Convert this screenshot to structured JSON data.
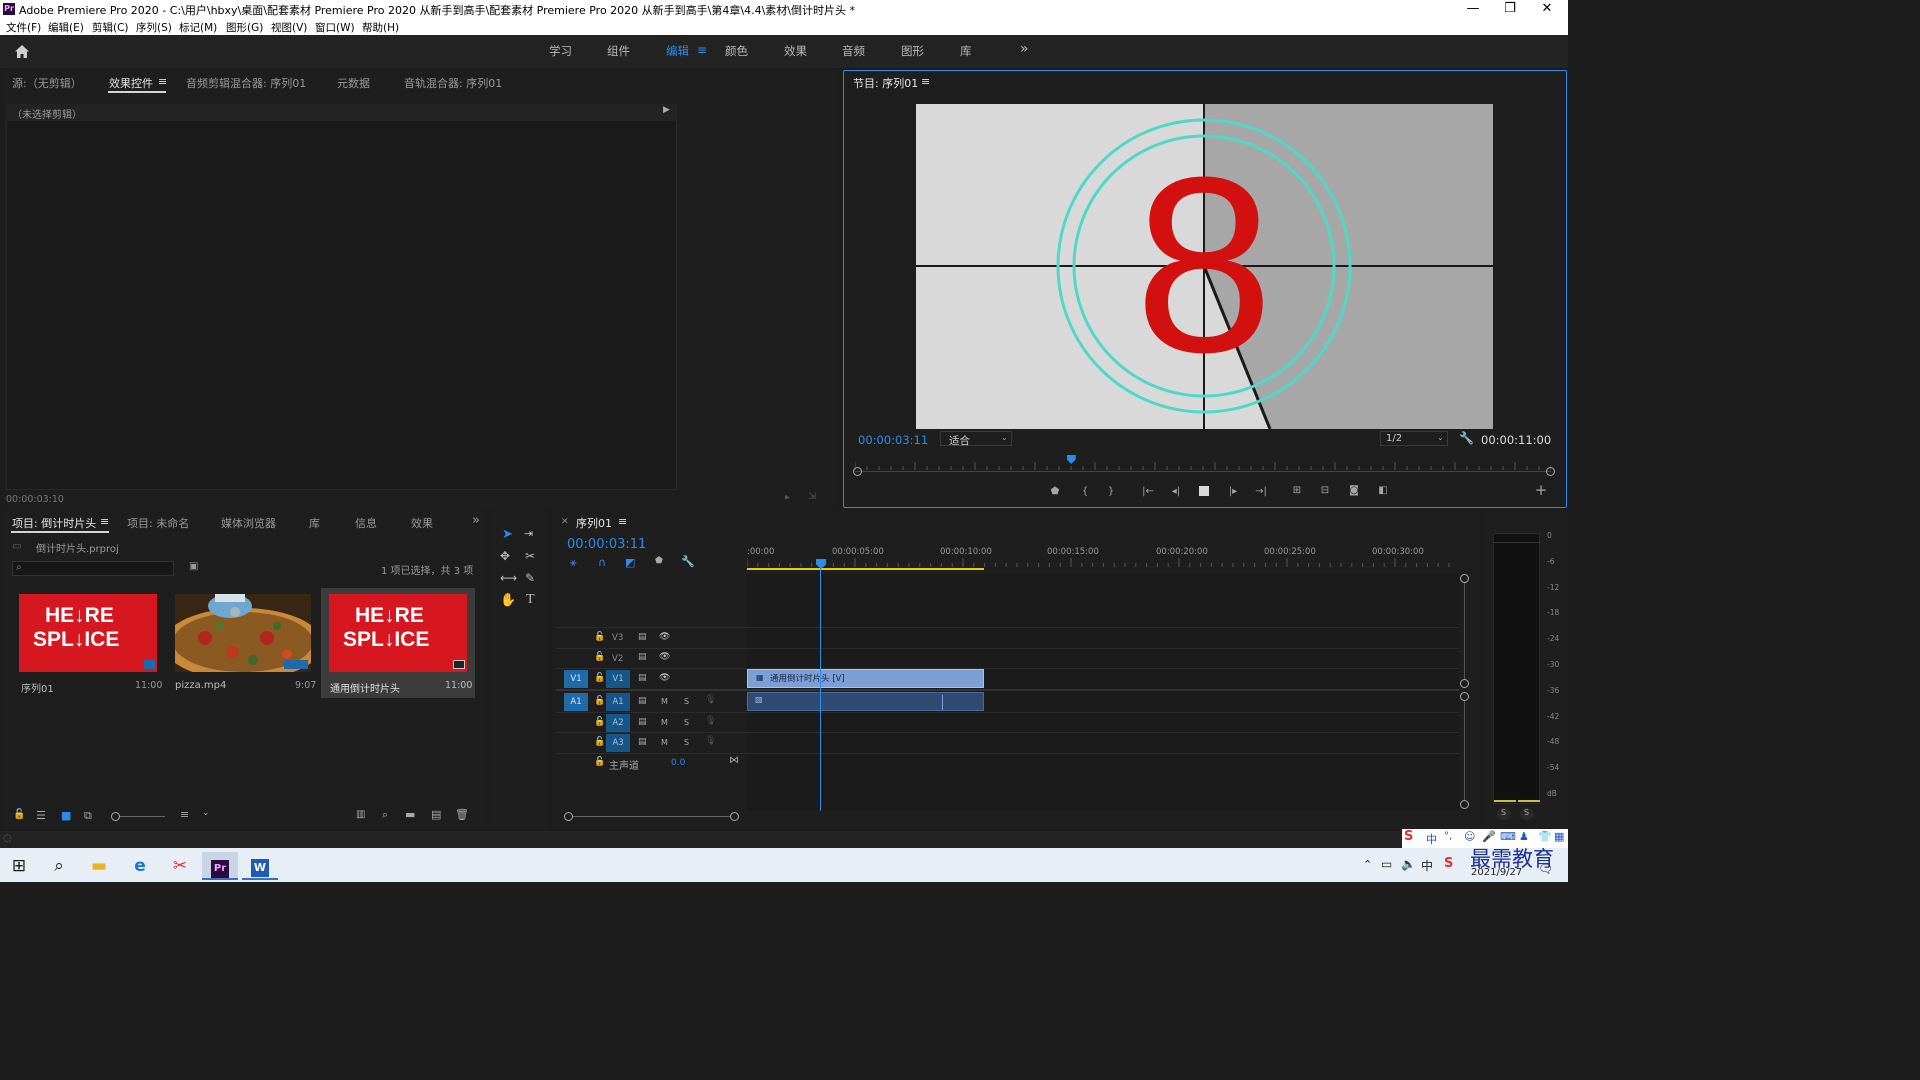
{
  "window": {
    "title": "Adobe Premiere Pro 2020 - C:\\用户\\hbxy\\桌面\\配套素材 Premiere Pro 2020 从新手到高手\\配套素材 Premiere Pro 2020 从新手到高手\\第4章\\4.4\\素材\\倒计时片头 *",
    "logo": "Pr",
    "minimize": "—",
    "restore": "❐",
    "close": "✕"
  },
  "menu": [
    "文件(F)",
    "编辑(E)",
    "剪辑(C)",
    "序列(S)",
    "标记(M)",
    "图形(G)",
    "视图(V)",
    "窗口(W)",
    "帮助(H)"
  ],
  "workspaces": {
    "items": [
      "学习",
      "组件",
      "编辑",
      "颜色",
      "效果",
      "音频",
      "图形",
      "库"
    ],
    "active": "编辑",
    "more": "»"
  },
  "source_panel": {
    "tabs": [
      "源:（无剪辑）",
      "效果控件",
      "音频剪辑混合器: 序列01",
      "元数据",
      "音轨混合器: 序列01"
    ],
    "active": "效果控件",
    "no_clip": "（未选择剪辑）",
    "timecode": "00:00:03:10"
  },
  "program_monitor": {
    "title": "节目: 序列01",
    "current_time": "00:00:03:11",
    "fit": "适合",
    "resolution": "1/2",
    "duration": "00:00:11:00",
    "countdown_number": "8",
    "playhead_fraction": 0.31
  },
  "project_panel": {
    "tabs": [
      "项目: 倒计时片头",
      "项目: 未命名",
      "媒体浏览器",
      "库",
      "信息",
      "效果"
    ],
    "active": "项目: 倒计时片头",
    "file": "倒计时片头.prproj",
    "selection": "1 项已选择，共 3 项",
    "items": [
      {
        "name": "序列01",
        "duration": "11:00",
        "thumb_text_top": "HE↓RE",
        "thumb_text_bottom": "SPL↓ICE"
      },
      {
        "name": "pizza.mp4",
        "duration": "9:07"
      },
      {
        "name": "通用倒计时片头",
        "duration": "11:00",
        "thumb_text_top": "HE↓RE",
        "thumb_text_bottom": "SPL↓ICE"
      }
    ]
  },
  "timeline": {
    "sequence": "序列01",
    "current_time": "00:00:03:11",
    "ruler": [
      ":00:00",
      "00:00:05:00",
      "00:00:10:00",
      "00:00:15:00",
      "00:00:20:00",
      "00:00:25:00",
      "00:00:30:00"
    ],
    "video_tracks": [
      "V3",
      "V2",
      "V1"
    ],
    "audio_tracks": [
      "A1",
      "A2",
      "A3"
    ],
    "master": "主声道",
    "master_value": "0.0",
    "clip_label": "通用倒计时片头 [V]",
    "track_btn_m": "M",
    "track_btn_s": "S"
  },
  "meter": {
    "scale": [
      "0",
      "-6",
      "-12",
      "-18",
      "-24",
      "-30",
      "-36",
      "-42",
      "-48",
      "-54",
      "dB"
    ],
    "solo_left": "S",
    "solo_right": "S"
  },
  "taskbar": {
    "date": "2021/9/27",
    "ime_label": "中",
    "watermark": "最需教育"
  },
  "colors": {
    "accent_blue": "#2d8ceb",
    "countdown_red": "#d21010",
    "ring_cyan": "#4fd8c8",
    "clip_video": "#7c9fd6",
    "clip_audio": "#2f4a73"
  }
}
